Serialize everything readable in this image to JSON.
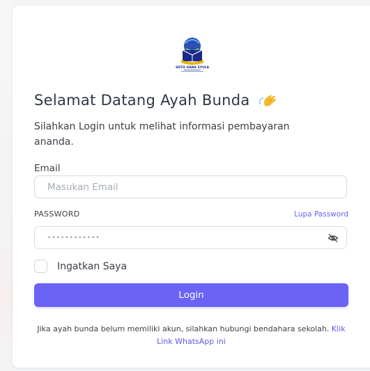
{
  "logo": {
    "icon": "school-logo-icon",
    "text": "SDTQ HANA SYULA",
    "colors": {
      "globe": "#2b4fb3",
      "book": "#1a2a8a",
      "banner": "#e8b400"
    }
  },
  "header": {
    "title": "Selamat Datang Ayah Bunda",
    "wave_icon": "waving-hand-icon",
    "subtitle": "Silahkan Login untuk melihat informasi pembayaran ananda."
  },
  "form": {
    "email_label": "Email",
    "email_placeholder": "Masukan Email",
    "password_label": "PASSWORD",
    "forgot_password": "Lupa Password",
    "password_value": "••••••••••••",
    "toggle_icon": "eye-off-icon",
    "remember_label": "Ingatkan Saya",
    "remember_checked": false,
    "login_label": "Login"
  },
  "footer": {
    "text": "Jika ayah bunda belum memiliki akun, silahkan hubungi bendahara sekolah.",
    "link_text": "Klik Link WhatsApp ini"
  },
  "colors": {
    "accent": "#6a63f5",
    "link": "#6366f1"
  }
}
